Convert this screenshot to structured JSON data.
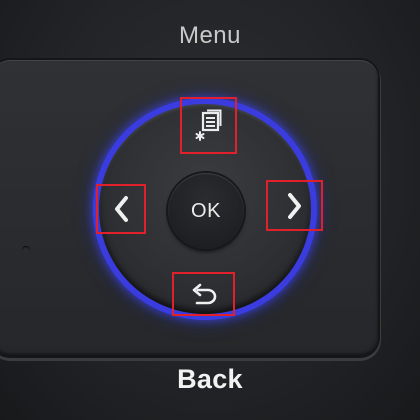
{
  "labels": {
    "top": "Menu",
    "bottom": "Back",
    "ok": "OK"
  },
  "icons": {
    "up": "menu-settings-icon",
    "left": "chevron-left-icon",
    "right": "chevron-right-icon",
    "down": "back-arrow-icon"
  },
  "colors": {
    "ring_glow": "#3a3ce0",
    "highlight": "#e0202a",
    "label_text": "#f2f2f2"
  }
}
